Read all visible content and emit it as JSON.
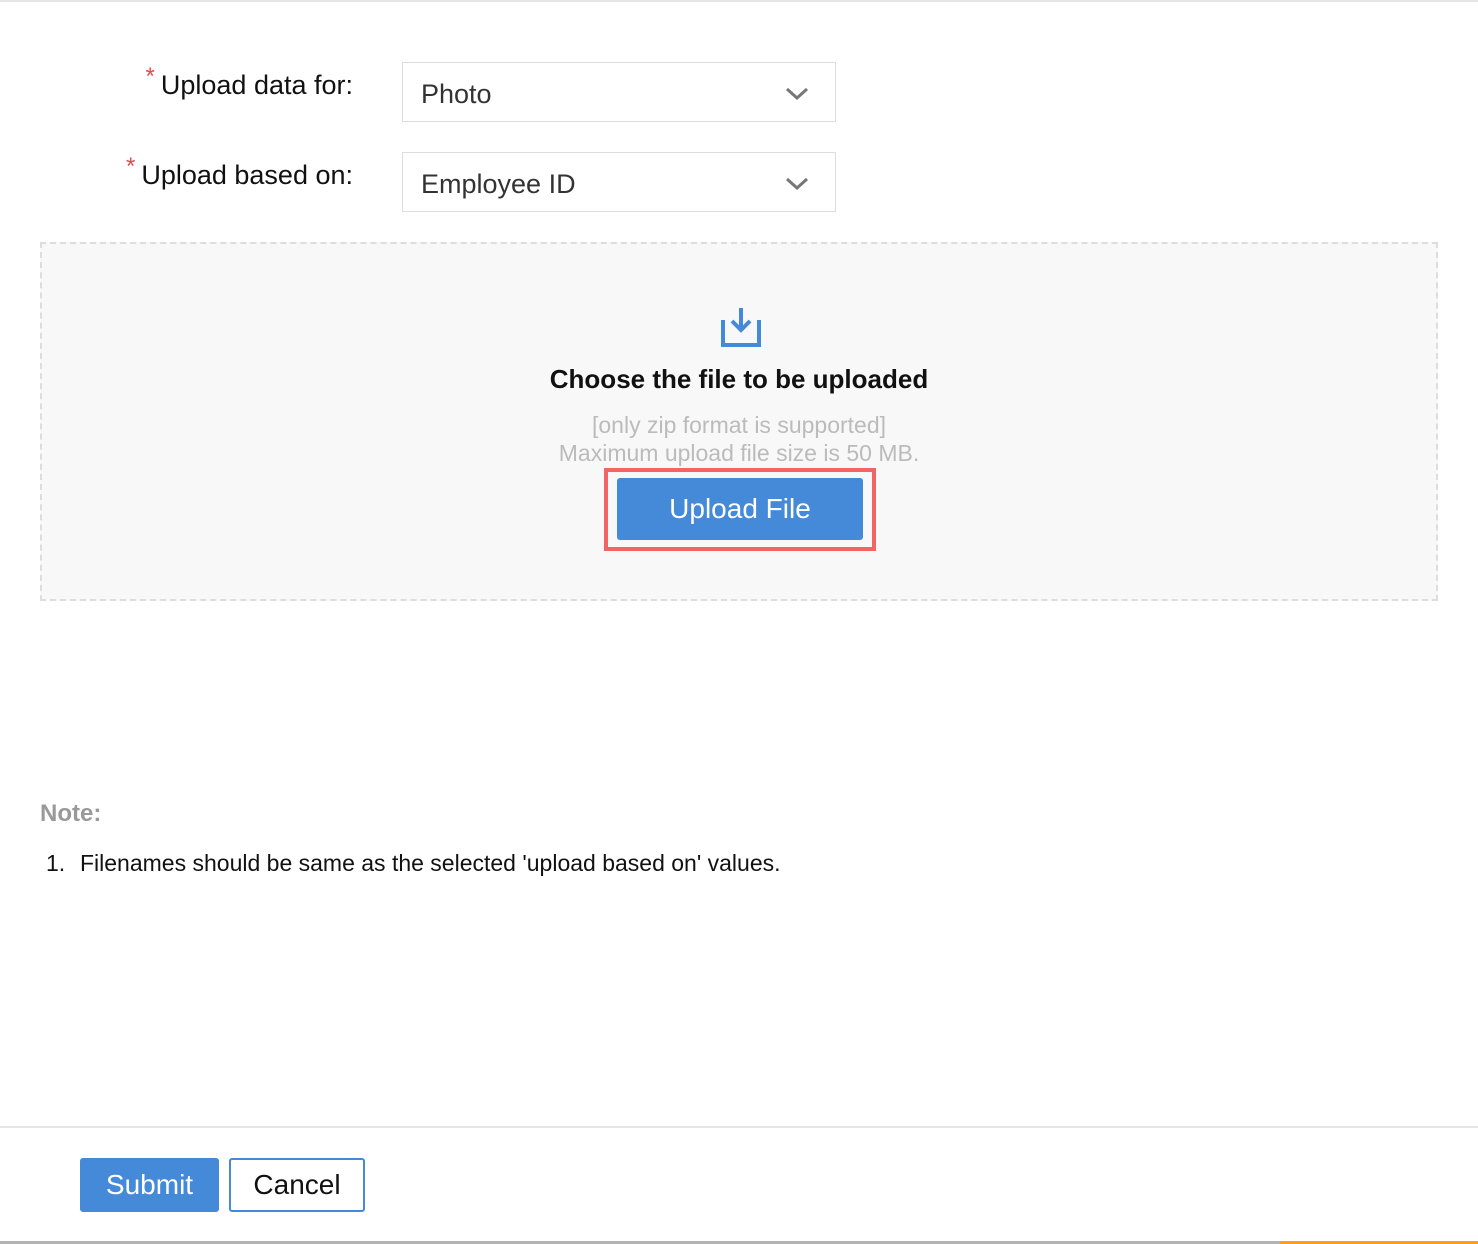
{
  "form": {
    "upload_for": {
      "label": "Upload data for:",
      "required_mark": "*",
      "value": "Photo"
    },
    "upload_based_on": {
      "label": "Upload based on:",
      "required_mark": "*",
      "value": "Employee ID"
    }
  },
  "dropzone": {
    "icon": "upload-tray-icon",
    "title": "Choose the file to be uploaded",
    "format_hint": "[only zip format is supported]",
    "size_hint": "Maximum upload file size is 50 MB.",
    "button_label": "Upload File"
  },
  "note": {
    "heading": "Note:",
    "items": [
      {
        "number": "1.",
        "text": "Filenames should be same as the selected 'upload based on' values."
      }
    ]
  },
  "footer": {
    "submit_label": "Submit",
    "cancel_label": "Cancel"
  },
  "colors": {
    "accent": "#448ad9",
    "required": "#e5484d",
    "highlight": "#f36464"
  }
}
